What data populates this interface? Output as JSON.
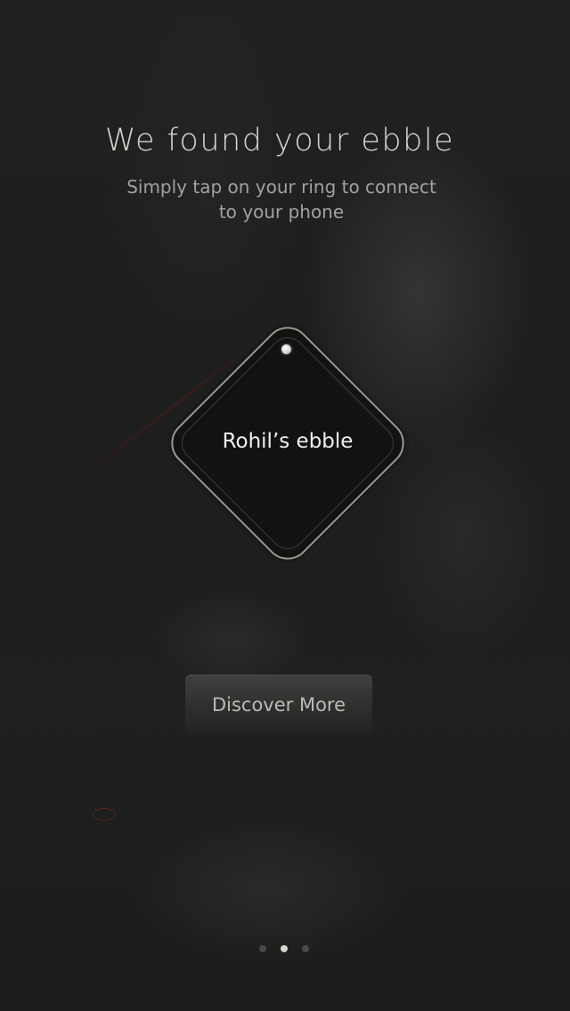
{
  "onboarding": {
    "title": "We found your ebble",
    "subtitle": "Simply tap on your ring to connect to your phone",
    "device_name": "Rohil’s ebble",
    "discover_button_label": "Discover More",
    "pager": {
      "total_pages": 3,
      "current_page": 2
    }
  },
  "colors": {
    "background": "#1c1d1d",
    "title": "#d6d3cc",
    "ring_border": "#9c998f",
    "active_dot": "#d8d5cf",
    "inactive_dot": "#4a4a48"
  }
}
